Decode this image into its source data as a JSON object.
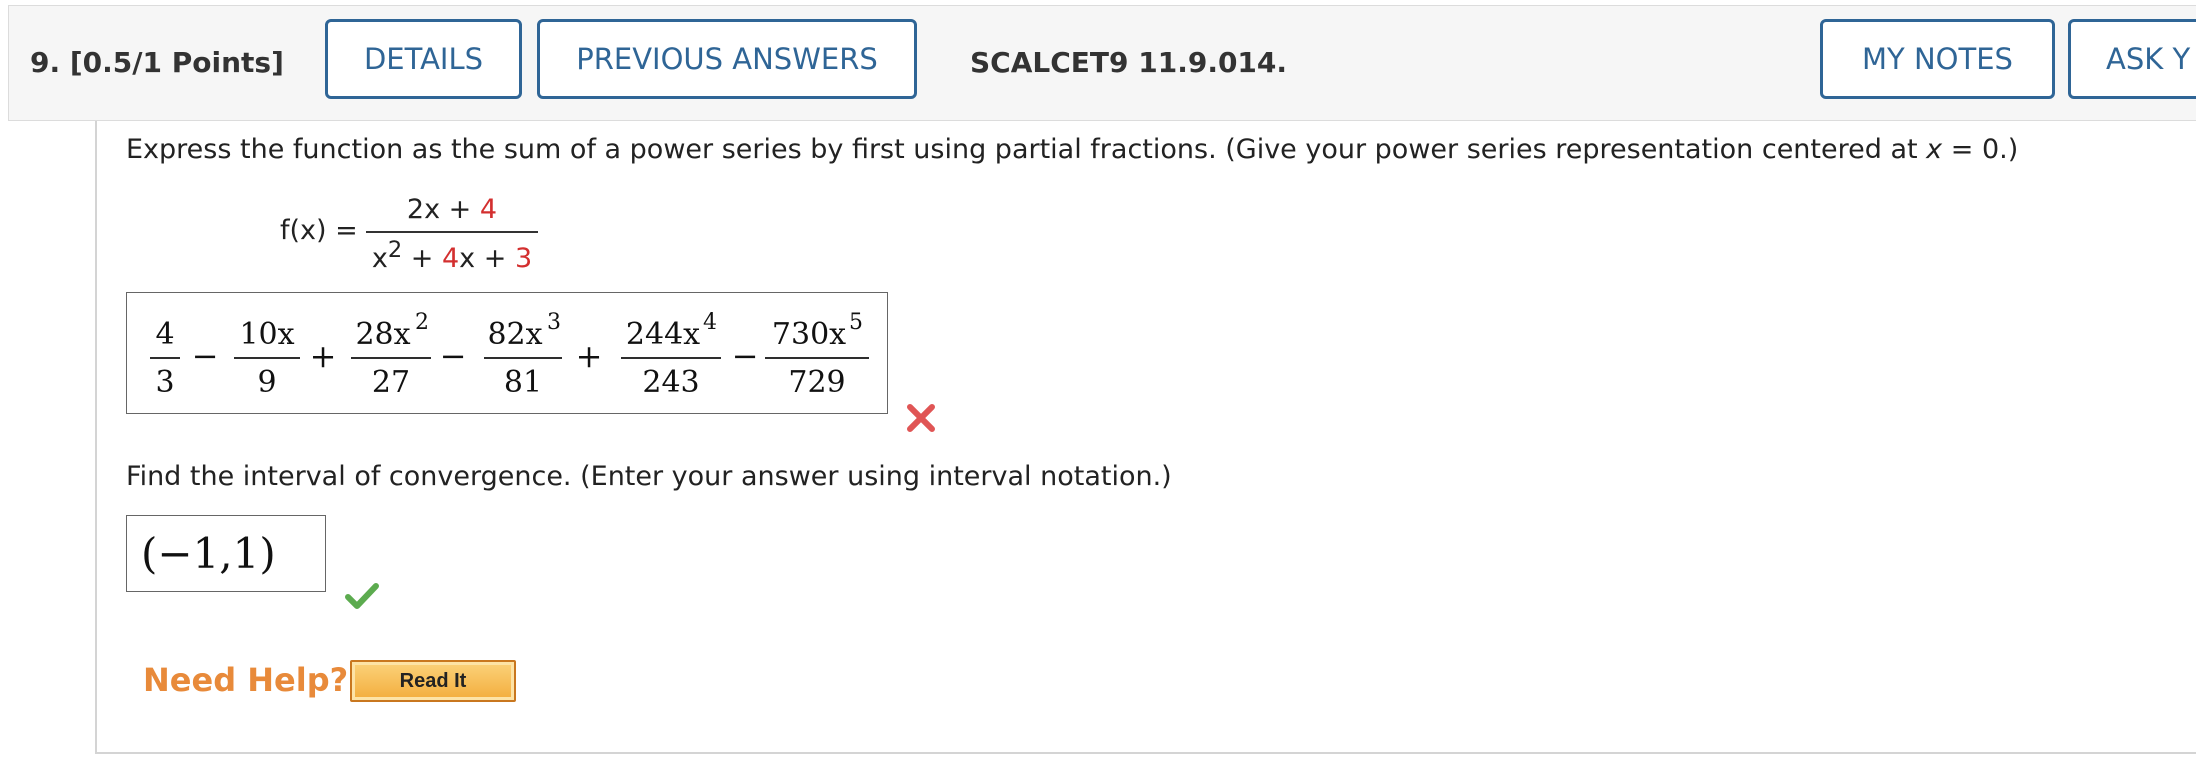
{
  "header": {
    "question_label": "9. [0.5/1 Points]",
    "details_button": "DETAILS",
    "previous_answers_button": "PREVIOUS ANSWERS",
    "question_ref": "SCALCET9 11.9.014.",
    "my_notes_button": "MY NOTES",
    "ask_button": "ASK Y"
  },
  "question": {
    "prompt_main": "Express the function as the sum of a power series by first using partial fractions. (Give your power series representation centered at ",
    "prompt_var": "x",
    "prompt_end": " = 0.)",
    "fx_label": "f(x) =",
    "num_a": "2x + ",
    "num_b": "4",
    "den_a": "x",
    "den_exp": "2",
    "den_b": " + ",
    "den_c": "4",
    "den_d": "x + ",
    "den_e": "3"
  },
  "answer1": {
    "terms": [
      {
        "sign": "",
        "numerator": "4",
        "power": "",
        "denominator": "3"
      },
      {
        "sign": "−",
        "numerator": "10x",
        "power": "",
        "denominator": "9"
      },
      {
        "sign": "+",
        "numerator": "28x",
        "power": "2",
        "denominator": "27"
      },
      {
        "sign": "−",
        "numerator": "82x",
        "power": "3",
        "denominator": "81"
      },
      {
        "sign": "+",
        "numerator": "244x",
        "power": "4",
        "denominator": "243"
      },
      {
        "sign": "−",
        "numerator": "730x",
        "power": "5",
        "denominator": "729"
      }
    ],
    "status": "incorrect",
    "status_icon": "x-mark-icon",
    "status_color": "#e05555"
  },
  "question2": {
    "prompt": "Find the interval of convergence. (Enter your answer using interval notation.)"
  },
  "answer2": {
    "value": "(−1,1)",
    "status": "correct",
    "status_icon": "checkmark-icon",
    "status_color": "#5cab4f"
  },
  "help": {
    "label": "Need Help?",
    "read_it_button": "Read It"
  },
  "colors": {
    "link_blue": "#2f6596",
    "red_number": "#d32f2f",
    "help_orange": "#e88a3a"
  }
}
